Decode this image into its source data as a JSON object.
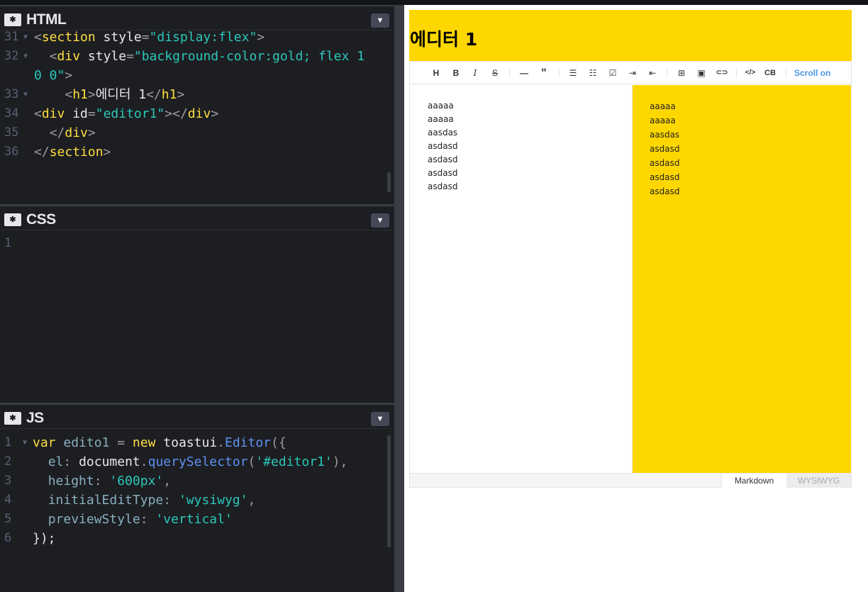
{
  "panels": {
    "html": {
      "title": "HTML",
      "lines": [
        {
          "n": "31",
          "fold": true
        },
        {
          "n": "32",
          "fold": true
        },
        {
          "n": "",
          "fold": false
        },
        {
          "n": "33",
          "fold": true
        },
        {
          "n": "34",
          "fold": false
        },
        {
          "n": "35",
          "fold": false
        },
        {
          "n": "36",
          "fold": false
        }
      ],
      "code": {
        "l31_tag": "section",
        "l31_attr": "style",
        "l31_val": "\"display:flex\"",
        "l32_tag": "div",
        "l32_attr": "style",
        "l32_val": "\"background-color:gold; flex 1",
        "l32b_val": "0 0\"",
        "l33_tag": "h1",
        "l33_text": "에디터 1",
        "l33_close": "h1",
        "l34_tag": "div",
        "l34_attr": "id",
        "l34_val": "\"editor1\"",
        "l34_close": "div",
        "l35_close": "div",
        "l36_close": "section"
      }
    },
    "css": {
      "title": "CSS",
      "lines": [
        "1"
      ]
    },
    "js": {
      "title": "JS",
      "lines": [
        "1",
        "2",
        "3",
        "4",
        "5",
        "6"
      ],
      "code": {
        "l1_kw": "var",
        "l1_var": "edito1",
        "l1_new": "new",
        "l1_obj": "toastui",
        "l1_cls": "Editor",
        "l2_prop": "el",
        "l2_obj": "document",
        "l2_fn": "querySelector",
        "l2_str": "'#editor1'",
        "l3_prop": "height",
        "l3_str": "'600px'",
        "l4_prop": "initialEditType",
        "l4_str": "'wysiwyg'",
        "l5_prop": "previewStyle",
        "l5_str": "'vertical'",
        "l6": "});"
      }
    }
  },
  "preview": {
    "heading": "에디터 1",
    "toolbar": {
      "buttons": [
        {
          "name": "heading",
          "glyph": "H"
        },
        {
          "name": "bold",
          "glyph": "B"
        },
        {
          "name": "italic",
          "glyph": "I"
        },
        {
          "name": "strike",
          "glyph": "S"
        },
        {
          "name": "hr",
          "glyph": "—"
        },
        {
          "name": "quote",
          "glyph": "“"
        },
        {
          "name": "ul",
          "glyph": "☰"
        },
        {
          "name": "ol",
          "glyph": "☷"
        },
        {
          "name": "task",
          "glyph": "☑"
        },
        {
          "name": "indent",
          "glyph": "⇥"
        },
        {
          "name": "outdent",
          "glyph": "⇤"
        },
        {
          "name": "table",
          "glyph": "⊞"
        },
        {
          "name": "image",
          "glyph": "▣"
        },
        {
          "name": "link",
          "glyph": "⊂⊃"
        },
        {
          "name": "code",
          "glyph": "</>"
        },
        {
          "name": "codeblock",
          "glyph": "CB"
        }
      ],
      "scroll_label": "Scroll on"
    },
    "markdown_lines": [
      "aaaaa",
      "aaaaa",
      "aasdas",
      "asdasd",
      "asdasd",
      "asdasd",
      "asdasd"
    ],
    "preview_lines": [
      "aaaaa",
      "aaaaa",
      "aasdas",
      "asdasd",
      "asdasd",
      "asdasd",
      "asdasd"
    ],
    "modes": {
      "markdown": "Markdown",
      "wysiwyg": "WYSIWYG"
    }
  }
}
